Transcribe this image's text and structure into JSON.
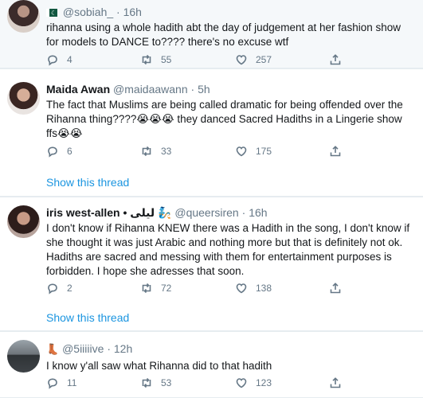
{
  "tweets": [
    {
      "name": "",
      "handle": "@sobiah_",
      "separator": "·",
      "time": "16h",
      "text": "rihanna using a whole hadith abt the day of judgement at her fashion show for models to DANCE to???? there's no excuse wtf",
      "replies": "4",
      "retweets": "55",
      "likes": "257",
      "show_thread": ""
    },
    {
      "name": "Maida Awan",
      "handle": "@maidaawann",
      "separator": "·",
      "time": "5h",
      "text": "The fact that Muslims are being called dramatic for being offended over the Rihanna thing????😭😭😭 they danced Sacred Hadiths in a Lingerie show ffs😭😭",
      "replies": "6",
      "retweets": "33",
      "likes": "175",
      "show_thread": "Show this thread"
    },
    {
      "name": "iris west-allen • ليلى 🧞",
      "handle": "@queersiren",
      "separator": "·",
      "time": "16h",
      "text": "I don't know if Rihanna KNEW there was a Hadith in the song, I don't know if she thought it was just Arabic and nothing more but that is definitely not ok. Hadiths are sacred and messing with them for entertainment purposes is forbidden. I hope she adresses that soon.",
      "replies": "2",
      "retweets": "72",
      "likes": "138",
      "show_thread": "Show this thread"
    },
    {
      "name": "",
      "handle": "@5iiiiive",
      "separator": "·",
      "time": "12h",
      "text": "I know y'all saw what Rihanna did to that hadith",
      "replies": "11",
      "retweets": "53",
      "likes": "123",
      "show_thread": ""
    }
  ],
  "icons": {
    "reply": "reply-icon",
    "retweet": "retweet-icon",
    "like": "like-icon",
    "share": "share-icon"
  },
  "colors": {
    "link": "#1b95e0",
    "muted": "#657786",
    "text": "#14171a",
    "divider": "#e6ecf0"
  }
}
